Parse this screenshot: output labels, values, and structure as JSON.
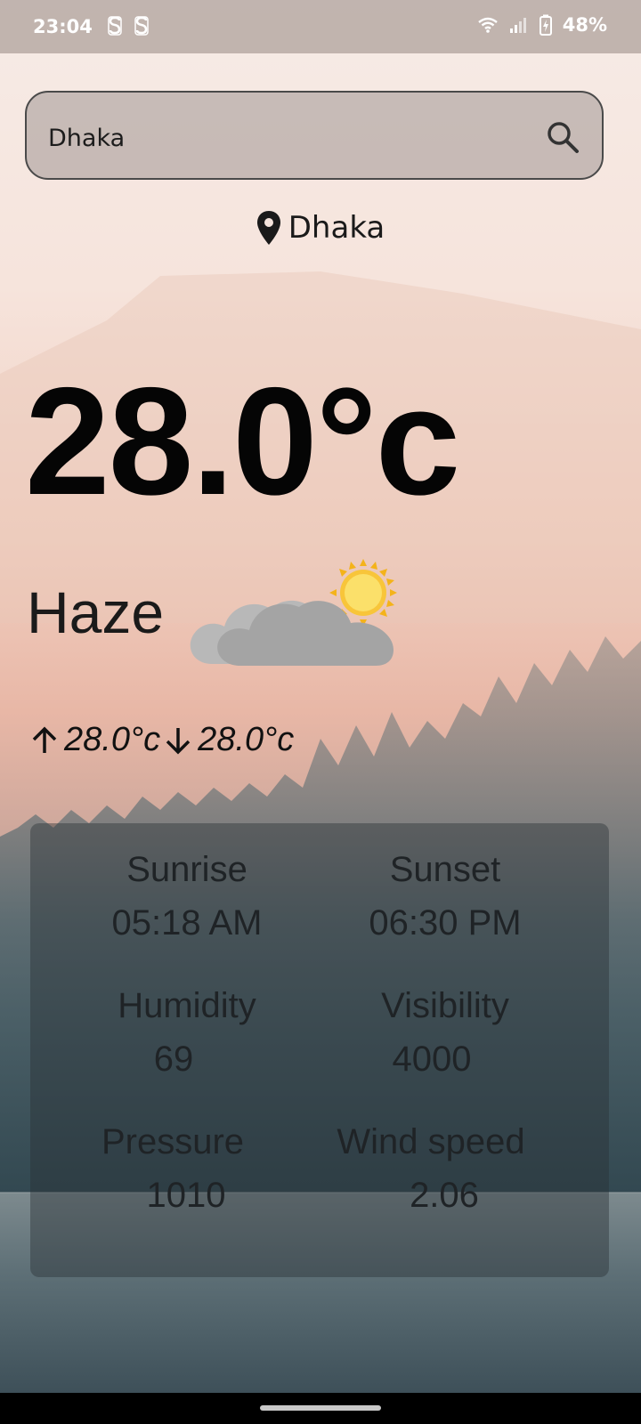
{
  "status_bar": {
    "time": "23:04",
    "battery_percent": "48%",
    "icons": [
      "s-app-icon",
      "s-app-icon",
      "wifi-icon",
      "signal-icon",
      "battery-charging-icon"
    ]
  },
  "search": {
    "value": "Dhaka",
    "placeholder": ""
  },
  "location": {
    "city": "Dhaka"
  },
  "weather": {
    "temperature": "28.0°c",
    "condition": "Haze",
    "condition_icon": "partly-cloudy-icon",
    "max_temp": "28.0°c",
    "min_temp": "28.0°c"
  },
  "details": {
    "sunrise_label": "Sunrise",
    "sunrise_value": "05:18 AM",
    "sunset_label": "Sunset",
    "sunset_value": "06:30 PM",
    "humidity_label": "Humidity",
    "humidity_value": "69",
    "visibility_label": "Visibility",
    "visibility_value": "4000",
    "pressure_label": "Pressure",
    "pressure_value": "1010",
    "wind_label": "Wind speed",
    "wind_value": "2.06"
  },
  "colors": {
    "sky_top": "#f7ece6",
    "sky_mid": "#efc6b7",
    "forest": "#3b5159",
    "water": "#4a5e66"
  }
}
